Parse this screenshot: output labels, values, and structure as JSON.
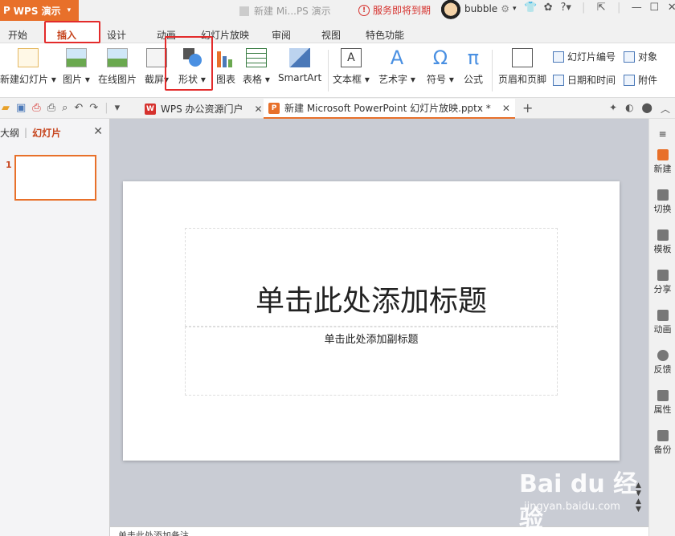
{
  "titlebar": {
    "app_name": "WPS 演示",
    "doc_title": "新建 Mi...PS 演示",
    "notice": "服务即将到期",
    "username": "bubble"
  },
  "tabs": [
    "开始",
    "插入",
    "设计",
    "动画",
    "幻灯片放映",
    "审阅",
    "视图",
    "特色功能"
  ],
  "ribbon": {
    "new_slide": "新建幻灯片",
    "picture": "图片",
    "online_picture": "在线图片",
    "screenshot": "截屏",
    "shape": "形状",
    "chart": "图表",
    "table": "表格",
    "smartart": "SmartArt",
    "textbox": "文本框",
    "wordart": "艺术字",
    "symbol": "符号",
    "formula": "公式",
    "header_footer": "页眉和页脚",
    "slide_number": "幻灯片编号",
    "object": "对象",
    "date_time": "日期和时间",
    "attachment": "附件"
  },
  "quickbar": {
    "tab1": "WPS 办公资源门户",
    "tab2": "新建 Microsoft PowerPoint 幻灯片放映.pptx *"
  },
  "leftpane": {
    "tab_outline": "大纲",
    "tab_slides": "幻灯片",
    "slide_number": "1"
  },
  "slide": {
    "title_placeholder": "单击此处添加标题",
    "subtitle_placeholder": "单击此处添加副标题"
  },
  "notes": "单击此处添加备注",
  "rightbar": [
    "新建",
    "切换",
    "模板",
    "分享",
    "动画",
    "反馈",
    "属性",
    "备份"
  ],
  "watermark": {
    "main": "Bai du 经验",
    "sub": "jingyan.baidu.com"
  },
  "colors": {
    "accent": "#e8702a",
    "highlight_box": "#e32b2b",
    "active_tab_text": "#c6441d"
  }
}
